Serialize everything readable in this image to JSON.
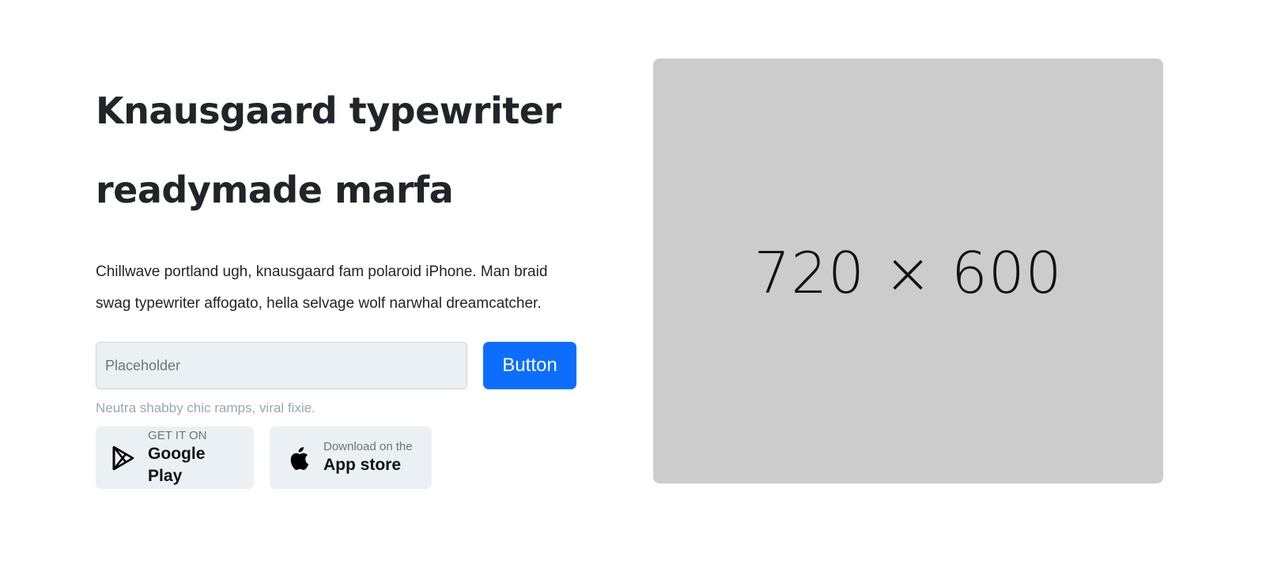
{
  "hero": {
    "title_line1": "Knausgaard typewriter",
    "title_line2": "readymade marfa",
    "lead": "Chillwave portland ugh, knausgaard fam polaroid iPhone. Man braid swag typewriter affogato, hella selvage wolf narwhal dreamcatcher.",
    "input_placeholder": "Placeholder",
    "button_label": "Button",
    "helper_text": "Neutra shabby chic ramps, viral fixie."
  },
  "stores": [
    {
      "small": "GET IT ON",
      "big": "Google Play",
      "icon": "google-play-icon"
    },
    {
      "small": "Download on the",
      "big": "App store",
      "icon": "apple-icon"
    }
  ],
  "image": {
    "label": "720 × 600"
  },
  "colors": {
    "primary": "#0d6efd",
    "input_bg": "#ebf0f4",
    "placeholder_bg": "#cccccc",
    "helper": "#9aa6b4"
  }
}
